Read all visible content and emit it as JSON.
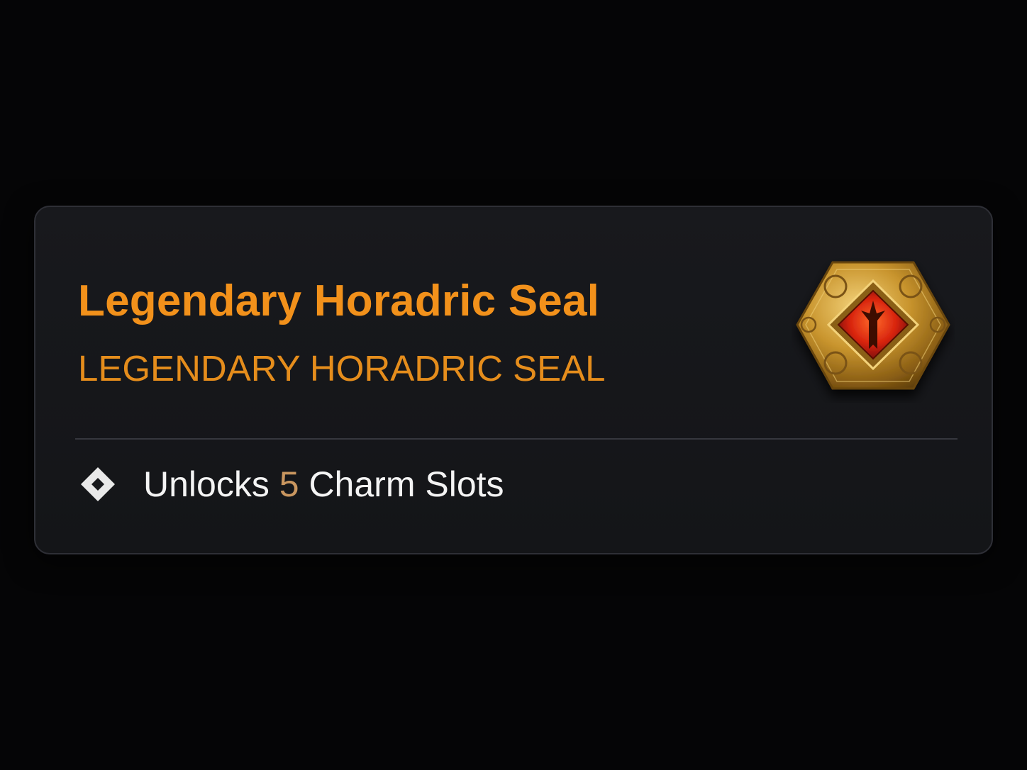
{
  "tooltip": {
    "item_name": "Legendary Horadric Seal",
    "item_type": "LEGENDARY HORADRIC SEAL",
    "affix": {
      "prefix": "Unlocks ",
      "value": "5",
      "suffix": " Charm Slots",
      "bullet_icon": "diamond-bullet-icon"
    },
    "item_icon": "horadric-seal-icon",
    "colors": {
      "legendary": "#f2911b",
      "affix_value": "#c9965f",
      "affix_text": "#f4f4f4"
    }
  }
}
